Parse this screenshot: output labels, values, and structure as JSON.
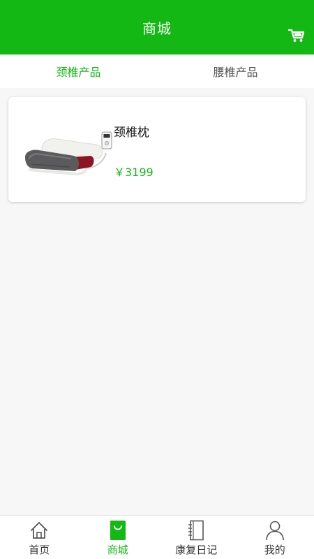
{
  "header": {
    "title": "商城",
    "cart_icon": "cart-icon",
    "background": "#14b814"
  },
  "tabs": [
    {
      "label": "颈椎产品",
      "active": true
    },
    {
      "label": "腰椎产品",
      "active": false
    }
  ],
  "products": [
    {
      "name": "颈椎枕",
      "price": "￥3199",
      "image_icon": "pillow-icon"
    }
  ],
  "bottom_nav": [
    {
      "label": "首页",
      "icon": "home-icon",
      "active": false
    },
    {
      "label": "商城",
      "icon": "shopping-bag-icon",
      "active": true
    },
    {
      "label": "康复日记",
      "icon": "diary-icon",
      "active": false
    },
    {
      "label": "我的",
      "icon": "user-icon",
      "active": false
    }
  ],
  "colors": {
    "accent": "#14b814",
    "text_primary": "#111111",
    "text_secondary": "#555555",
    "background": "#f7f7f7"
  }
}
